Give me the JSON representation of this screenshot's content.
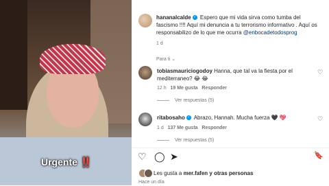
{
  "post": {
    "username": "hananalcalde",
    "verified": "✓",
    "caption": "Espero que mi vida sirva como tumba del fascismo !!!! Aquí mi denuncia a tu terrorismo informativo . Aquí os responsabilizo de lo que me ocurra",
    "mention": "@enbocadetodosprog",
    "age": "1 d",
    "translate": "Para ti",
    "chevron": "⌄"
  },
  "media": {
    "caption_text": "Urgente",
    "caption_bang": "‼️"
  },
  "comments": [
    {
      "username": "tobiasmauriciogodoy",
      "text": "Hanna, que tal va la fiesta por el mediterraneo? 😂 😂",
      "age": "12 h",
      "likes": "19 Me gusta",
      "reply": "Responder",
      "view_replies": "Ver respuestas (5)"
    },
    {
      "username": "ritabosaho",
      "verified": "✓",
      "text": "Abrazo, Hannah. Mucha fuerza 🖤 💖",
      "age": "1 d",
      "likes": "137 Me gusta",
      "reply": "Responder",
      "view_replies": "Ver respuestas (5)"
    }
  ],
  "actions": {
    "like": "♡",
    "comment": "◯",
    "share": "➤",
    "save": "🔖"
  },
  "likes_summary": {
    "prefix": "Les gusta a",
    "user": "mer.fafen",
    "suffix": "y otras personas"
  },
  "footer_age": "Hace un día",
  "colors": {
    "link": "#00376b",
    "verified": "#0095f6",
    "muted": "#737373"
  }
}
